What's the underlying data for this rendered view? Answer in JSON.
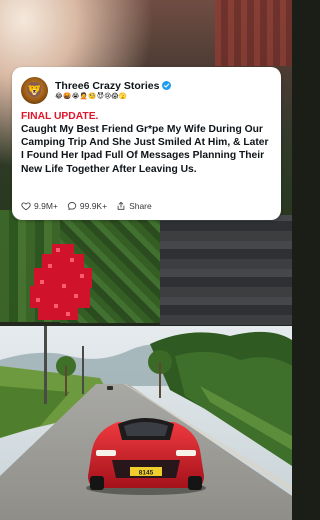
{
  "post": {
    "account_name": "Three6 Crazy Stories",
    "emoji_line": "😂🤬😭🤦🧐😈😢😱🫣",
    "avatar_emoji": "🦁",
    "update_label": "FINAL UPDATE.",
    "body": "Caught My Best Friend Gr*pe My Wife During Our Camping Trip And She Just Smiled At Him, & Later I Found Her Ipad Full Of Messages Planning Their New Life Together After Leaving Us.",
    "likes": "9.9M+",
    "comments": "99.9K+",
    "share_label": "Share"
  },
  "car": {
    "plate": "8145",
    "color": "#d31c25"
  },
  "colors": {
    "accent_red": "#e0162b",
    "verified_blue": "#1d9bf0"
  },
  "icons": [
    "verified-badge-icon",
    "heart-icon",
    "comment-icon",
    "share-icon"
  ]
}
